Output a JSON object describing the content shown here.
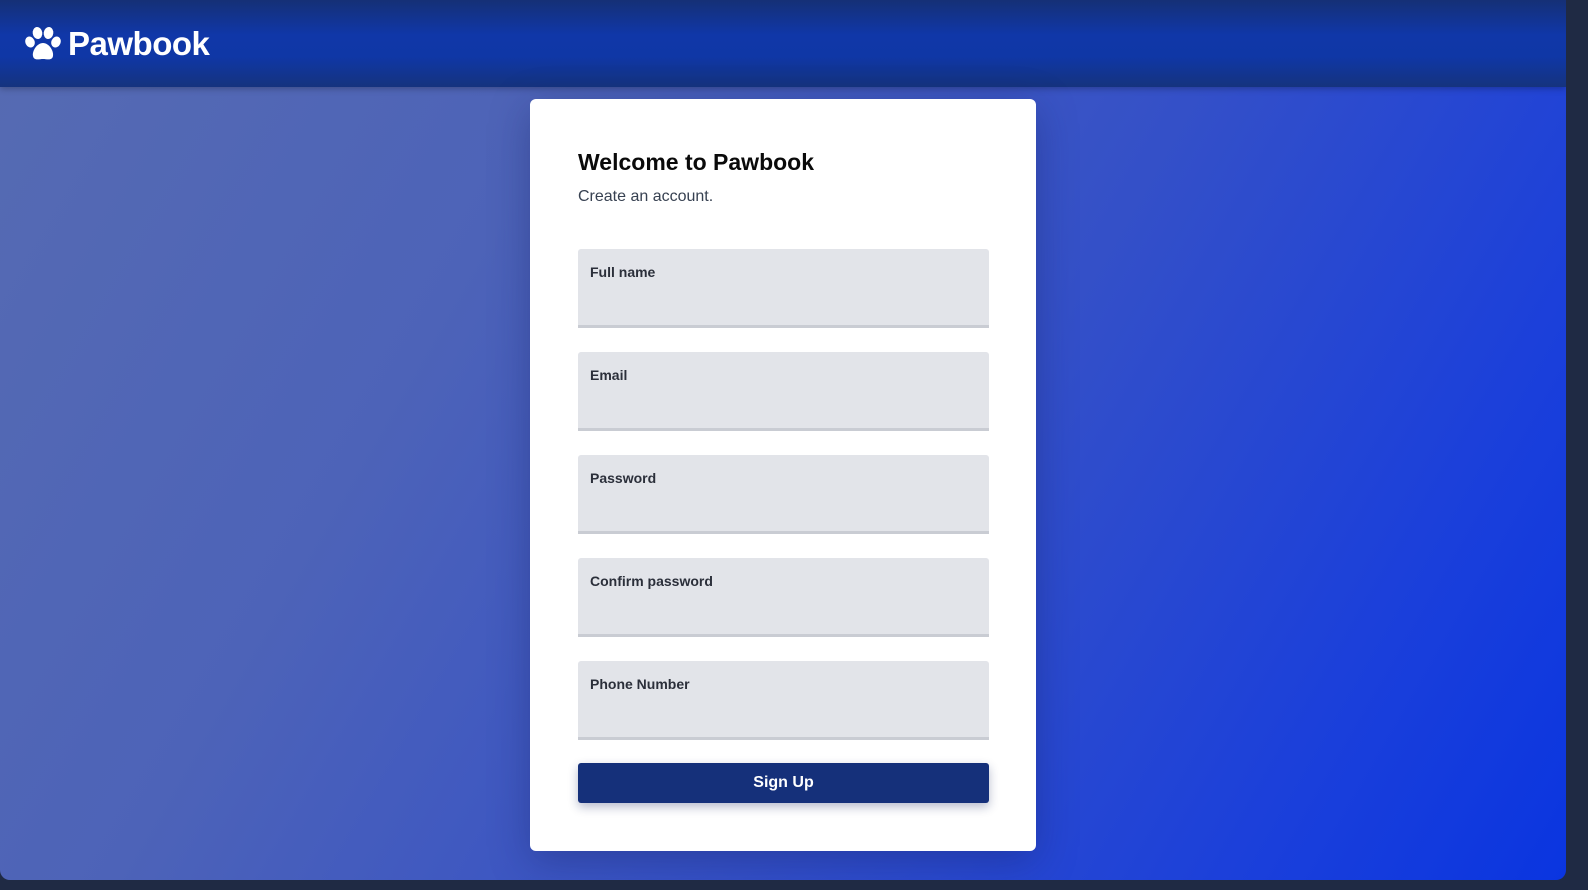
{
  "header": {
    "brand_name": "Pawbook",
    "brand_icon": "paw-icon"
  },
  "card": {
    "title": "Welcome to Pawbook",
    "subtitle": "Create an account."
  },
  "form": {
    "fields": [
      {
        "label": "Full name",
        "value": ""
      },
      {
        "label": "Email",
        "value": ""
      },
      {
        "label": "Password",
        "value": ""
      },
      {
        "label": "Confirm password",
        "value": ""
      },
      {
        "label": "Phone Number",
        "value": ""
      }
    ],
    "submit_label": "Sign Up"
  },
  "colors": {
    "header_bg": "#1037a8",
    "button_bg": "#15307a",
    "field_bg": "#e2e4e9",
    "gradient_start": "#566bb2",
    "gradient_end": "#0a35e0"
  }
}
